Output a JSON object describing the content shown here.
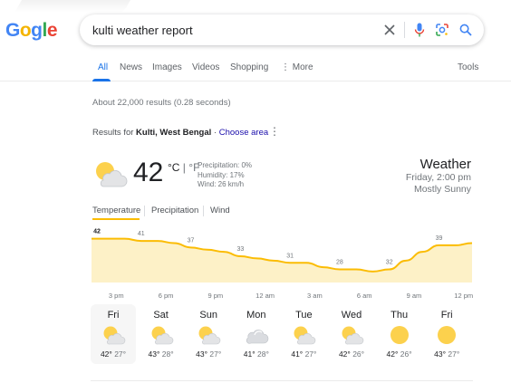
{
  "logo": {
    "letters": [
      "G",
      "o",
      "g",
      "l",
      "e"
    ]
  },
  "search": {
    "query": "kulti weather report"
  },
  "tabs": [
    {
      "label": "All",
      "active": true
    },
    {
      "label": "News"
    },
    {
      "label": "Images"
    },
    {
      "label": "Videos"
    },
    {
      "label": "Shopping"
    },
    {
      "label": "⋮ More"
    }
  ],
  "tools_label": "Tools",
  "stats": "About 22,000 results (0.28 seconds)",
  "results_for": {
    "prefix": "Results for ",
    "place": "Kulti, West Bengal",
    "sep": " · ",
    "link": "Choose area"
  },
  "weather": {
    "temperature": "42",
    "unit_c": "°C",
    "unit_sep": " | ",
    "unit_f": "°F",
    "precipitation": "Precipitation: 0%",
    "humidity": "Humidity: 17%",
    "wind": "Wind: 26 km/h",
    "title": "Weather",
    "datetime": "Friday, 2:00 pm",
    "condition": "Mostly Sunny",
    "current_icon": "partly-cloudy-icon"
  },
  "weather_tabs": [
    "Temperature",
    "Precipitation",
    "Wind"
  ],
  "chart_data": {
    "type": "area",
    "x": [
      "2 pm",
      "3 pm",
      "4 pm",
      "5 pm",
      "6 pm",
      "7 pm",
      "8 pm",
      "9 pm",
      "10 pm",
      "11 pm",
      "12 am",
      "1 am",
      "2 am",
      "3 am",
      "4 am",
      "5 am",
      "6 am",
      "7 am",
      "8 am",
      "9 am",
      "10 am",
      "11 am",
      "12 pm",
      "1 pm"
    ],
    "values": [
      42,
      42,
      42,
      41,
      41,
      40,
      38,
      37,
      36,
      34,
      33,
      32,
      31,
      31,
      29,
      28,
      28,
      27,
      28,
      32,
      36,
      39,
      39,
      40
    ],
    "value_labels": [
      {
        "index": 0,
        "text": "42"
      },
      {
        "index": 3,
        "text": "41"
      },
      {
        "index": 6,
        "text": "37"
      },
      {
        "index": 9,
        "text": "33"
      },
      {
        "index": 12,
        "text": "31"
      },
      {
        "index": 15,
        "text": "28"
      },
      {
        "index": 18,
        "text": "32"
      },
      {
        "index": 21,
        "text": "39"
      }
    ],
    "tick_labels": [
      {
        "index": 1,
        "text": "3 pm"
      },
      {
        "index": 4,
        "text": "6 pm"
      },
      {
        "index": 7,
        "text": "9 pm"
      },
      {
        "index": 10,
        "text": "12 am"
      },
      {
        "index": 13,
        "text": "3 am"
      },
      {
        "index": 16,
        "text": "6 am"
      },
      {
        "index": 19,
        "text": "9 am"
      },
      {
        "index": 22,
        "text": "12 pm"
      }
    ],
    "ylim": [
      22,
      46
    ],
    "line_color": "#fbbc04",
    "fill_color": "#fdf1c7"
  },
  "forecast": [
    {
      "day": "Fri",
      "hi": "42°",
      "lo": "27°",
      "icon": "partly-cloudy-icon",
      "selected": true
    },
    {
      "day": "Sat",
      "hi": "43°",
      "lo": "28°",
      "icon": "partly-cloudy-icon"
    },
    {
      "day": "Sun",
      "hi": "43°",
      "lo": "27°",
      "icon": "partly-cloudy-icon"
    },
    {
      "day": "Mon",
      "hi": "41°",
      "lo": "28°",
      "icon": "cloudy-icon"
    },
    {
      "day": "Tue",
      "hi": "41°",
      "lo": "27°",
      "icon": "partly-cloudy-icon"
    },
    {
      "day": "Wed",
      "hi": "42°",
      "lo": "26°",
      "icon": "partly-cloudy-icon"
    },
    {
      "day": "Thu",
      "hi": "42°",
      "lo": "26°",
      "icon": "sunny-icon"
    },
    {
      "day": "Fri",
      "hi": "43°",
      "lo": "27°",
      "icon": "sunny-icon"
    }
  ]
}
